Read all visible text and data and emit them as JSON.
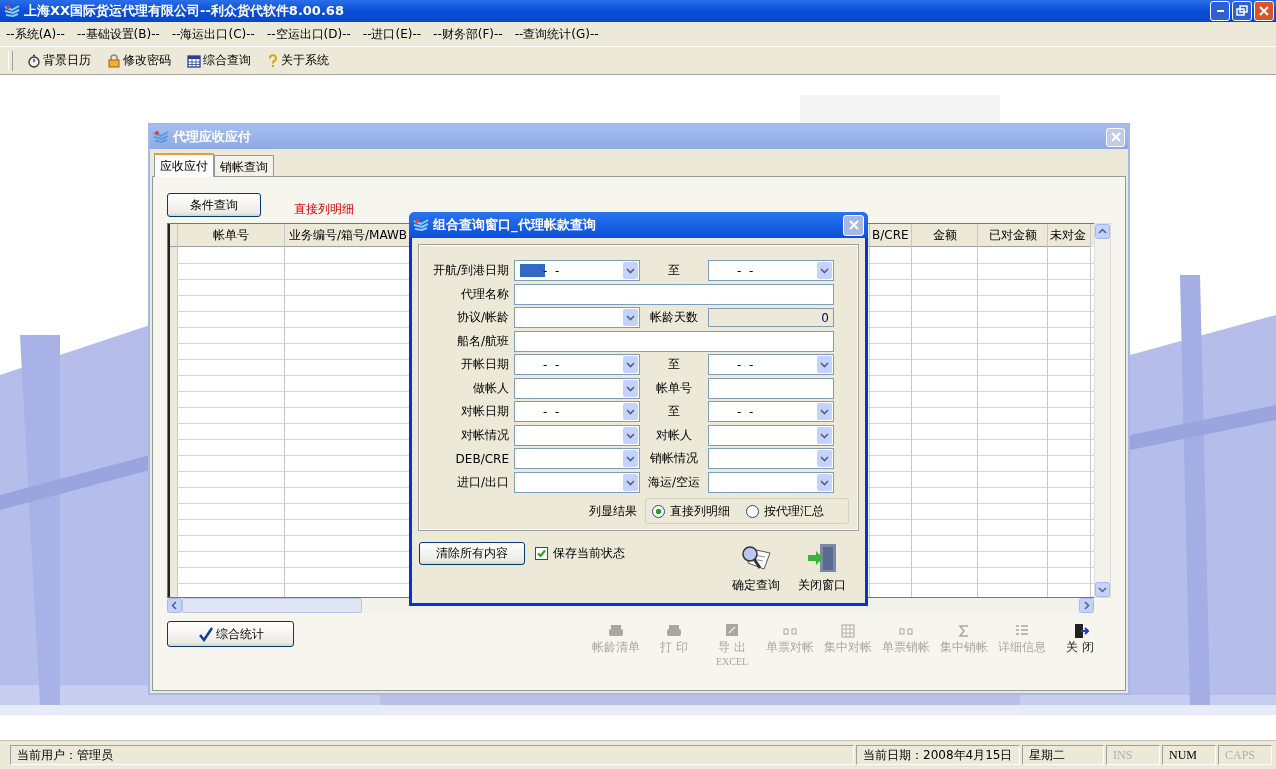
{
  "app": {
    "title": "上海XX国际货运代理有限公司--利众货代软件8.00.68"
  },
  "menu": [
    "--系统(A)--",
    "--基础设置(B)--",
    "--海运出口(C)--",
    "--空运出口(D)--",
    "--进口(E)--",
    "--财务部(F)--",
    "--查询统计(G)--"
  ],
  "toolbar": [
    {
      "label": "背景日历"
    },
    {
      "label": "修改密码"
    },
    {
      "label": "综合查询"
    },
    {
      "label": "关于系统"
    }
  ],
  "child_window": {
    "title": "代理应收应付",
    "tabs": [
      {
        "label": "应收应付",
        "selected": true
      },
      {
        "label": "销帐查询",
        "selected": false
      }
    ],
    "query_button": "条件查询",
    "mode_label": "直接列明细",
    "table": {
      "columns": [
        "帐单号",
        "业务编号/箱号/MAWB",
        "B/CRE",
        "金额",
        "已对金额",
        "未对金"
      ]
    },
    "stats_button": "综合统计",
    "actions": [
      {
        "label": "帐龄清单",
        "disabled": true
      },
      {
        "label": "打 印",
        "disabled": true
      },
      {
        "label": "导 出",
        "sublabel": "EXCEL",
        "disabled": true
      },
      {
        "label": "单票对帐",
        "disabled": true
      },
      {
        "label": "集中对帐",
        "disabled": true
      },
      {
        "label": "单票销帐",
        "disabled": true
      },
      {
        "label": "集中销帐",
        "disabled": true
      },
      {
        "label": "详细信息",
        "disabled": true
      },
      {
        "label": "关 闭",
        "disabled": false
      }
    ]
  },
  "dialog": {
    "title": "组合查询窗口_代理帐款查询",
    "rows": [
      [
        {
          "label": "开航/到港日期",
          "kind": "date",
          "value": "-  -",
          "selected": true
        },
        {
          "label": "至",
          "kind": "date",
          "value": "-  -",
          "selected": false
        }
      ],
      [
        {
          "label": "代理名称",
          "kind": "text"
        }
      ],
      [
        {
          "label": "协议/帐龄",
          "kind": "combo"
        },
        {
          "label": "帐龄天数",
          "kind": "number",
          "value": "0"
        }
      ],
      [
        {
          "label": "船名/航班",
          "kind": "text"
        }
      ],
      [
        {
          "label": "开帐日期",
          "kind": "date",
          "value": "-  -",
          "selected": false
        },
        {
          "label": "至",
          "kind": "date",
          "value": "-  -",
          "selected": false
        }
      ],
      [
        {
          "label": "做帐人",
          "kind": "combo"
        },
        {
          "label": "帐单号",
          "kind": "text"
        }
      ],
      [
        {
          "label": "对帐日期",
          "kind": "date",
          "value": "-  -",
          "selected": false
        },
        {
          "label": "至",
          "kind": "date",
          "value": "-  -",
          "selected": false
        }
      ],
      [
        {
          "label": "对帐情况",
          "kind": "combo"
        },
        {
          "label": "对帐人",
          "kind": "combo"
        }
      ],
      [
        {
          "label": "DEB/CRE",
          "kind": "combo"
        },
        {
          "label": "销帐情况",
          "kind": "combo"
        }
      ],
      [
        {
          "label": "进口/出口",
          "kind": "combo"
        },
        {
          "label": "海运/空运",
          "kind": "combo"
        }
      ]
    ],
    "result_label": "列显结果",
    "result_options": [
      {
        "label": "直接列明细",
        "selected": true
      },
      {
        "label": "按代理汇总",
        "selected": false
      }
    ],
    "clear_button": "清除所有内容",
    "save_state": {
      "label": "保存当前状态",
      "checked": true
    },
    "confirm_button": "确定查询",
    "close_button": "关闭窗口"
  },
  "status_bar": {
    "user": "当前用户：管理员",
    "date": "当前日期：2008年4月15日",
    "weekday": "星期二",
    "keys": [
      {
        "label": "INS",
        "on": false
      },
      {
        "label": "NUM",
        "on": true
      },
      {
        "label": "CAPS",
        "on": false
      }
    ]
  }
}
